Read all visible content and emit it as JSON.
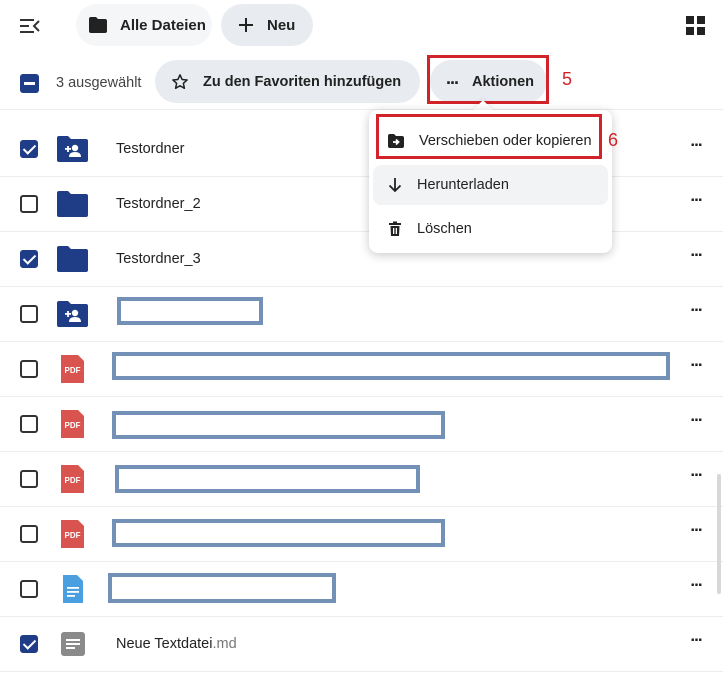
{
  "header": {
    "breadcrumb_label": "Alle Dateien",
    "new_label": "Neu"
  },
  "selection": {
    "count_text": "3 ausgewählt",
    "favorite_label": "Zu den Favoriten hinzufügen",
    "actions_label": "Aktionen"
  },
  "annotations": {
    "step_actions": "5",
    "step_move": "6"
  },
  "actions_menu": {
    "items": [
      {
        "label": "Verschieben oder kopieren",
        "icon": "folder-move-icon"
      },
      {
        "label": "Herunterladen",
        "icon": "arrow-down-icon"
      },
      {
        "label": "Löschen",
        "icon": "trash-icon"
      }
    ]
  },
  "files": {
    "rows": [
      {
        "name": "Testordner",
        "ext": "",
        "type": "shared-folder",
        "checked": true
      },
      {
        "name": "Testordner_2",
        "ext": "",
        "type": "folder",
        "checked": false
      },
      {
        "name": "Testordner_3",
        "ext": "",
        "type": "folder",
        "checked": true
      },
      {
        "name": "",
        "ext": "",
        "type": "shared-folder",
        "checked": false
      },
      {
        "name": "",
        "ext": "",
        "type": "pdf",
        "checked": false
      },
      {
        "name": "",
        "ext": "",
        "type": "pdf",
        "checked": false
      },
      {
        "name": "",
        "ext": "",
        "type": "pdf",
        "checked": false
      },
      {
        "name": "",
        "ext": "",
        "type": "pdf",
        "checked": false
      },
      {
        "name": "",
        "ext": "",
        "type": "text",
        "checked": false
      },
      {
        "name": "Neue Textdatei",
        "ext": ".md",
        "type": "markdown",
        "checked": true
      }
    ],
    "pdf_badge": "PDF"
  },
  "colors": {
    "accent": "#1f3d87",
    "annotation": "#d2232a",
    "redaction": "#7391b7",
    "pdf": "#d9534f"
  }
}
